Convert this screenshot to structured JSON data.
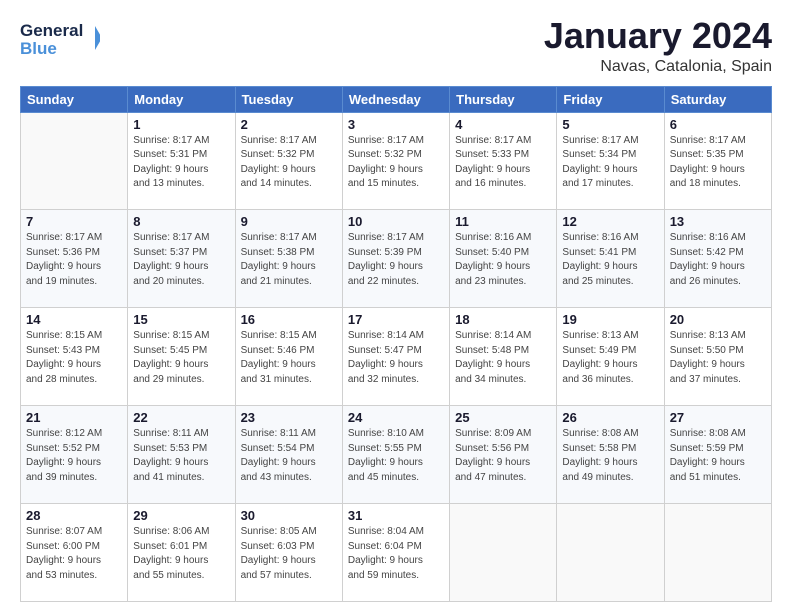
{
  "logo": {
    "line1": "General",
    "line2": "Blue"
  },
  "title": "January 2024",
  "location": "Navas, Catalonia, Spain",
  "days_header": [
    "Sunday",
    "Monday",
    "Tuesday",
    "Wednesday",
    "Thursday",
    "Friday",
    "Saturday"
  ],
  "weeks": [
    [
      {
        "day": "",
        "info": ""
      },
      {
        "day": "1",
        "info": "Sunrise: 8:17 AM\nSunset: 5:31 PM\nDaylight: 9 hours\nand 13 minutes."
      },
      {
        "day": "2",
        "info": "Sunrise: 8:17 AM\nSunset: 5:32 PM\nDaylight: 9 hours\nand 14 minutes."
      },
      {
        "day": "3",
        "info": "Sunrise: 8:17 AM\nSunset: 5:32 PM\nDaylight: 9 hours\nand 15 minutes."
      },
      {
        "day": "4",
        "info": "Sunrise: 8:17 AM\nSunset: 5:33 PM\nDaylight: 9 hours\nand 16 minutes."
      },
      {
        "day": "5",
        "info": "Sunrise: 8:17 AM\nSunset: 5:34 PM\nDaylight: 9 hours\nand 17 minutes."
      },
      {
        "day": "6",
        "info": "Sunrise: 8:17 AM\nSunset: 5:35 PM\nDaylight: 9 hours\nand 18 minutes."
      }
    ],
    [
      {
        "day": "7",
        "info": "Sunrise: 8:17 AM\nSunset: 5:36 PM\nDaylight: 9 hours\nand 19 minutes."
      },
      {
        "day": "8",
        "info": "Sunrise: 8:17 AM\nSunset: 5:37 PM\nDaylight: 9 hours\nand 20 minutes."
      },
      {
        "day": "9",
        "info": "Sunrise: 8:17 AM\nSunset: 5:38 PM\nDaylight: 9 hours\nand 21 minutes."
      },
      {
        "day": "10",
        "info": "Sunrise: 8:17 AM\nSunset: 5:39 PM\nDaylight: 9 hours\nand 22 minutes."
      },
      {
        "day": "11",
        "info": "Sunrise: 8:16 AM\nSunset: 5:40 PM\nDaylight: 9 hours\nand 23 minutes."
      },
      {
        "day": "12",
        "info": "Sunrise: 8:16 AM\nSunset: 5:41 PM\nDaylight: 9 hours\nand 25 minutes."
      },
      {
        "day": "13",
        "info": "Sunrise: 8:16 AM\nSunset: 5:42 PM\nDaylight: 9 hours\nand 26 minutes."
      }
    ],
    [
      {
        "day": "14",
        "info": "Sunrise: 8:15 AM\nSunset: 5:43 PM\nDaylight: 9 hours\nand 28 minutes."
      },
      {
        "day": "15",
        "info": "Sunrise: 8:15 AM\nSunset: 5:45 PM\nDaylight: 9 hours\nand 29 minutes."
      },
      {
        "day": "16",
        "info": "Sunrise: 8:15 AM\nSunset: 5:46 PM\nDaylight: 9 hours\nand 31 minutes."
      },
      {
        "day": "17",
        "info": "Sunrise: 8:14 AM\nSunset: 5:47 PM\nDaylight: 9 hours\nand 32 minutes."
      },
      {
        "day": "18",
        "info": "Sunrise: 8:14 AM\nSunset: 5:48 PM\nDaylight: 9 hours\nand 34 minutes."
      },
      {
        "day": "19",
        "info": "Sunrise: 8:13 AM\nSunset: 5:49 PM\nDaylight: 9 hours\nand 36 minutes."
      },
      {
        "day": "20",
        "info": "Sunrise: 8:13 AM\nSunset: 5:50 PM\nDaylight: 9 hours\nand 37 minutes."
      }
    ],
    [
      {
        "day": "21",
        "info": "Sunrise: 8:12 AM\nSunset: 5:52 PM\nDaylight: 9 hours\nand 39 minutes."
      },
      {
        "day": "22",
        "info": "Sunrise: 8:11 AM\nSunset: 5:53 PM\nDaylight: 9 hours\nand 41 minutes."
      },
      {
        "day": "23",
        "info": "Sunrise: 8:11 AM\nSunset: 5:54 PM\nDaylight: 9 hours\nand 43 minutes."
      },
      {
        "day": "24",
        "info": "Sunrise: 8:10 AM\nSunset: 5:55 PM\nDaylight: 9 hours\nand 45 minutes."
      },
      {
        "day": "25",
        "info": "Sunrise: 8:09 AM\nSunset: 5:56 PM\nDaylight: 9 hours\nand 47 minutes."
      },
      {
        "day": "26",
        "info": "Sunrise: 8:08 AM\nSunset: 5:58 PM\nDaylight: 9 hours\nand 49 minutes."
      },
      {
        "day": "27",
        "info": "Sunrise: 8:08 AM\nSunset: 5:59 PM\nDaylight: 9 hours\nand 51 minutes."
      }
    ],
    [
      {
        "day": "28",
        "info": "Sunrise: 8:07 AM\nSunset: 6:00 PM\nDaylight: 9 hours\nand 53 minutes."
      },
      {
        "day": "29",
        "info": "Sunrise: 8:06 AM\nSunset: 6:01 PM\nDaylight: 9 hours\nand 55 minutes."
      },
      {
        "day": "30",
        "info": "Sunrise: 8:05 AM\nSunset: 6:03 PM\nDaylight: 9 hours\nand 57 minutes."
      },
      {
        "day": "31",
        "info": "Sunrise: 8:04 AM\nSunset: 6:04 PM\nDaylight: 9 hours\nand 59 minutes."
      },
      {
        "day": "",
        "info": ""
      },
      {
        "day": "",
        "info": ""
      },
      {
        "day": "",
        "info": ""
      }
    ]
  ]
}
